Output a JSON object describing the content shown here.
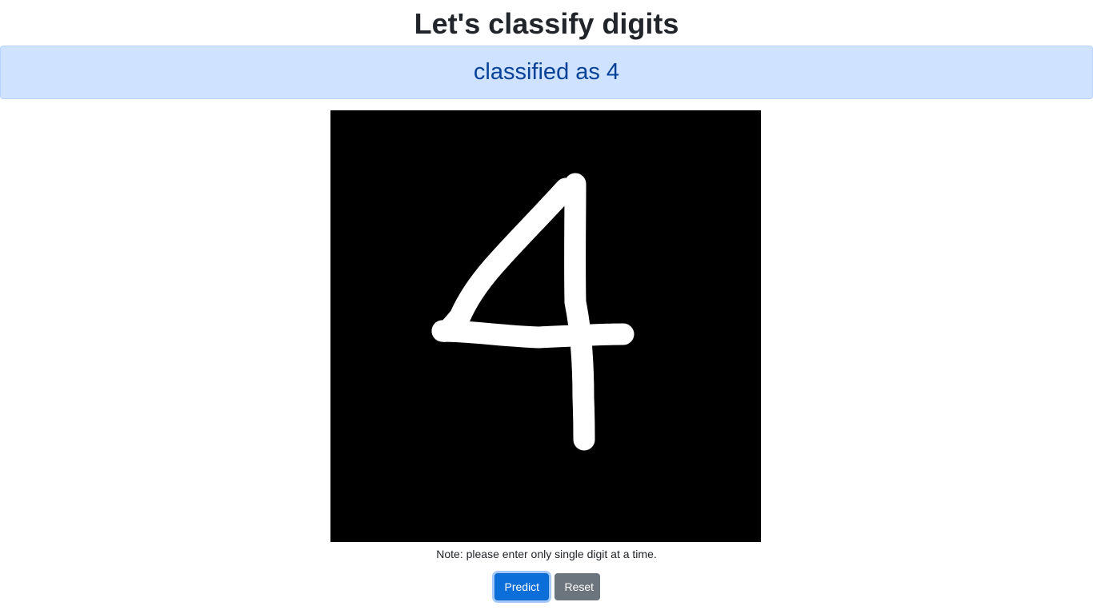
{
  "header": {
    "title": "Let's classify digits"
  },
  "result": {
    "text": "classified as 4"
  },
  "canvas": {
    "background_color": "#000000",
    "stroke_color": "#ffffff"
  },
  "note": {
    "text": "Note: please enter only single digit at a time."
  },
  "actions": {
    "predict_label": "Predict",
    "reset_label": "Reset",
    "predict_color": "#0b6ed9",
    "reset_color": "#6c757d"
  },
  "colors": {
    "alert_bg": "#cfe2ff",
    "alert_text": "#084298"
  }
}
